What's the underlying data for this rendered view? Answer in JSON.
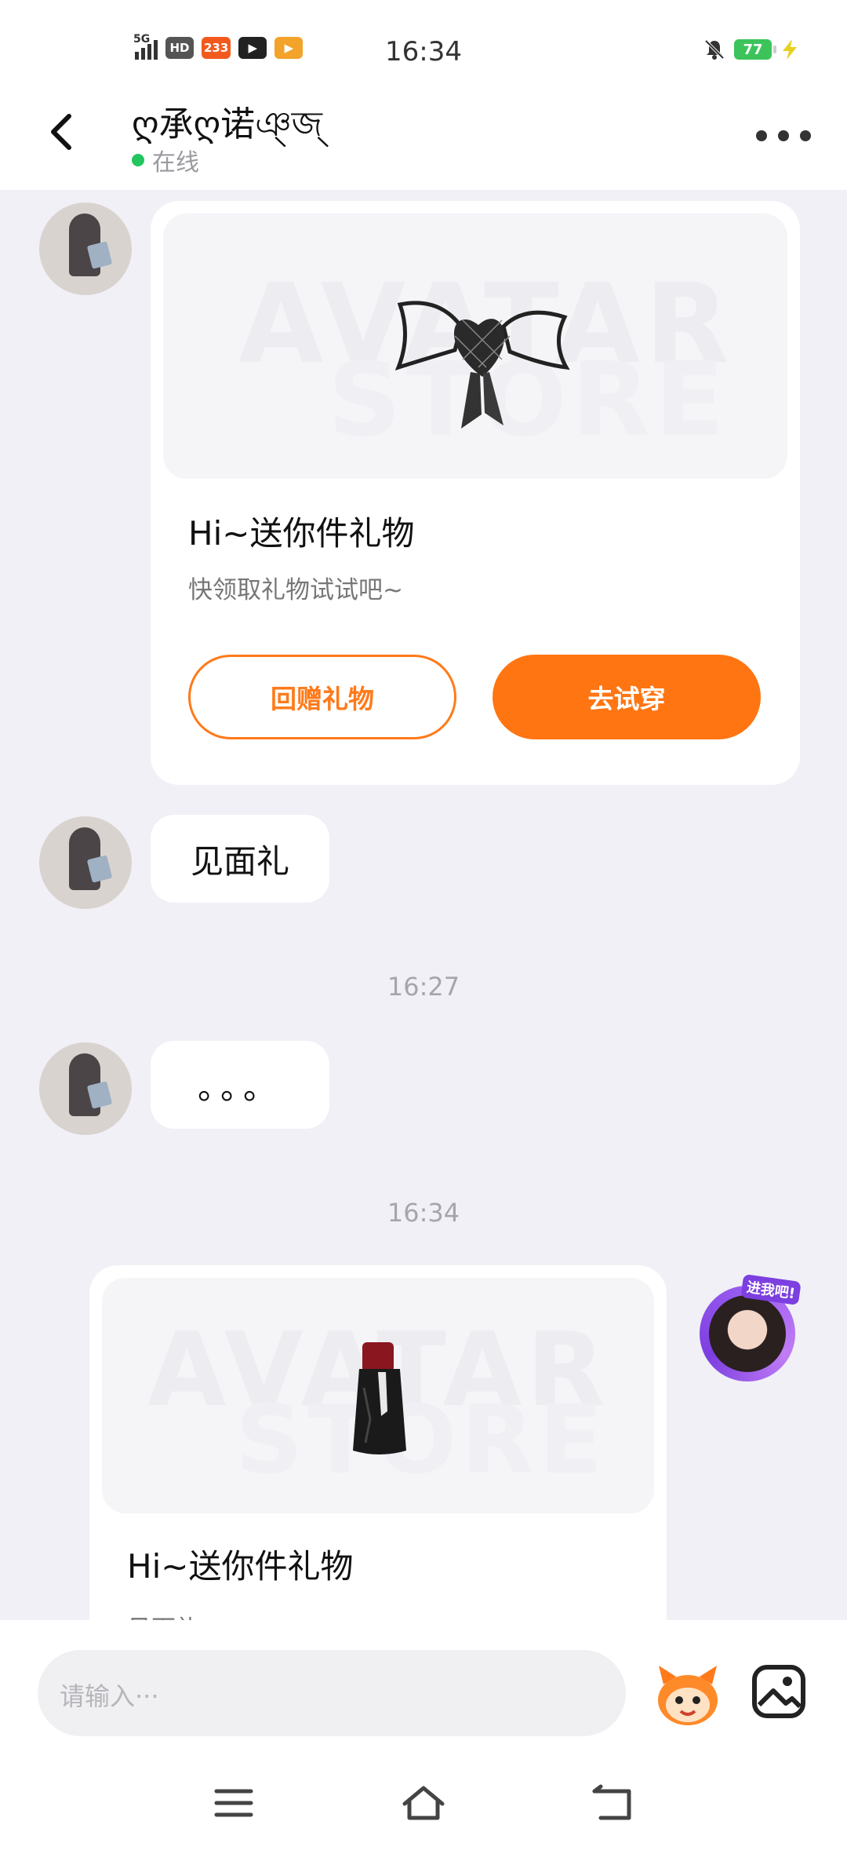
{
  "status_bar": {
    "network": "5G",
    "badges": [
      "HD",
      "233",
      "▶",
      "▶"
    ],
    "time": "16:34",
    "battery": "77"
  },
  "header": {
    "contact_name": "ღ承ღ诺ঞ্জ্",
    "status": "在线"
  },
  "messages": {
    "gift_card_1": {
      "watermark_top": "AVATAR",
      "watermark_bottom": "STORE",
      "title": "Hi~送你件礼物",
      "subtitle": "快领取礼物试试吧~",
      "return_gift_label": "回赠礼物",
      "try_on_label": "去试穿"
    },
    "text_1": "见面礼",
    "time_1": "16:27",
    "text_2": "。。。",
    "time_2": "16:34",
    "gift_card_2": {
      "watermark_top": "AVATAR",
      "watermark_bottom": "STORE",
      "title": "Hi~送你件礼物",
      "subtitle": "见面礼"
    },
    "self_avatar_badge": "进我吧!"
  },
  "input_bar": {
    "placeholder": "请输入···"
  },
  "colors": {
    "accent": "#ff7512",
    "online": "#22c55e",
    "background": "#f0f0f6"
  },
  "icons": {
    "back": "chevron-left-icon",
    "more": "more-dots-icon",
    "sticker": "mascot-icon",
    "image": "image-icon",
    "nav_menu": "menu-icon",
    "nav_home": "home-icon",
    "nav_back": "return-icon"
  }
}
